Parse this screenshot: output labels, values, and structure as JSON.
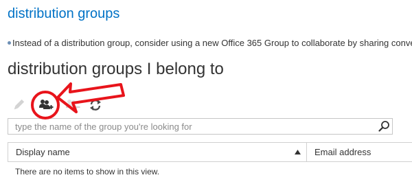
{
  "page": {
    "title": "distribution groups",
    "info_text": "Instead of a distribution group, consider using a new Office 365 Group to collaborate by sharing conversations"
  },
  "section": {
    "title": "distribution groups I belong to"
  },
  "toolbar": {
    "icons": [
      "pencil-icon",
      "join-group-icon",
      "leave-group-icon",
      "refresh-icon"
    ]
  },
  "search": {
    "placeholder": "type the name of the group you're looking for",
    "value": ""
  },
  "grid": {
    "columns": [
      "Display name",
      "Email address"
    ],
    "sorted_column": "Display name",
    "sort_direction": "ascending",
    "empty_message": "There are no items to show in this view."
  },
  "colors": {
    "accent": "#0072c6",
    "annotation": "#e8141b"
  }
}
